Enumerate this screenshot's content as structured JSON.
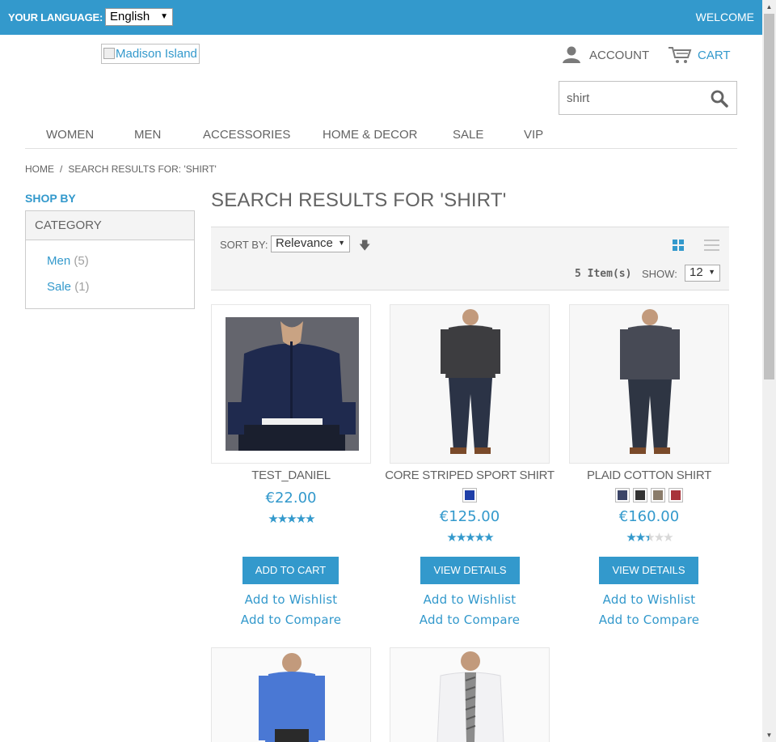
{
  "topbar": {
    "language_label": "YOUR LANGUAGE:",
    "language_value": "English",
    "welcome": "WELCOME"
  },
  "header": {
    "logo_alt": "Madison Island",
    "account": "ACCOUNT",
    "cart": "CART",
    "search_value": "shirt"
  },
  "nav": [
    "WOMEN",
    "MEN",
    "ACCESSORIES",
    "HOME & DECOR",
    "SALE",
    "VIP"
  ],
  "breadcrumb": {
    "home": "HOME",
    "separator": "/",
    "current": "SEARCH RESULTS FOR: 'SHIRT'"
  },
  "sidebar": {
    "shop_by": "SHOP BY",
    "category_title": "CATEGORY",
    "categories": [
      {
        "label": "Men",
        "count": "(5)"
      },
      {
        "label": "Sale",
        "count": "(1)"
      }
    ]
  },
  "main": {
    "title": "SEARCH RESULTS FOR 'SHIRT'",
    "toolbar": {
      "sort_by_label": "SORT BY:",
      "sort_value": "Relevance",
      "items_count": "5 Item(s)",
      "show_label": "SHOW:",
      "show_value": "12"
    }
  },
  "products": [
    {
      "name": "TEST_DANIEL",
      "price": "€22.00",
      "rating_stars": 5,
      "swatches": [],
      "button": "ADD TO CART",
      "wishlist": "Add to Wishlist",
      "compare": "Add to Compare"
    },
    {
      "name": "CORE STRIPED SPORT SHIRT",
      "price": "€125.00",
      "rating_stars": 5,
      "swatches": [
        "#1f3fa8"
      ],
      "button": "VIEW DETAILS",
      "wishlist": "Add to Wishlist",
      "compare": "Add to Compare"
    },
    {
      "name": "PLAID COTTON SHIRT",
      "price": "€160.00",
      "rating_stars": 2.5,
      "swatches": [
        "#3c4568",
        "#333333",
        "#8a7c6a",
        "#a8333a"
      ],
      "button": "VIEW DETAILS",
      "wishlist": "Add to Wishlist",
      "compare": "Add to Compare"
    },
    {
      "name": "",
      "price": ""
    },
    {
      "name": "",
      "price": ""
    }
  ],
  "colors": {
    "accent": "#3399cc",
    "text": "#636363",
    "toolbar_bg": "#f4f4f4"
  }
}
